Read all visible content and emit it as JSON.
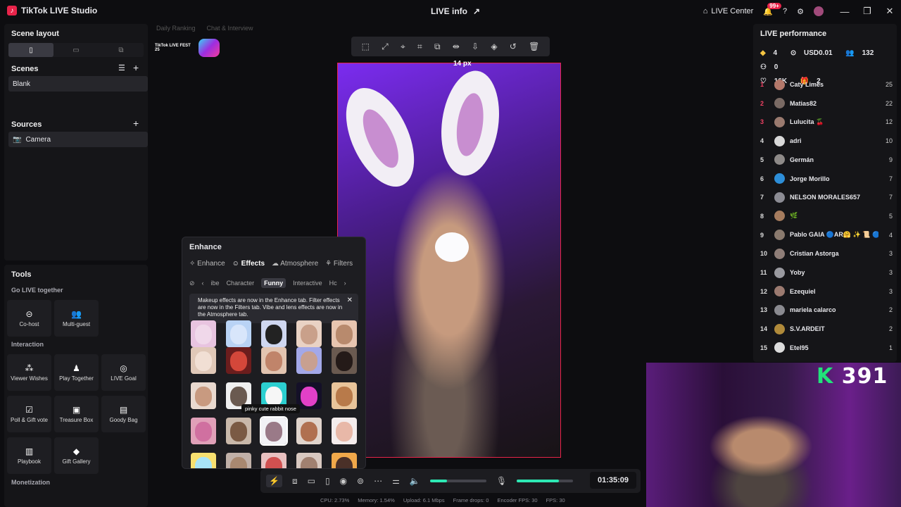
{
  "app": {
    "title": "TikTok LIVE Studio",
    "logo": "tiktok-icon"
  },
  "titlebar": {
    "center_title": "LIVE info",
    "live_center": "LIVE Center",
    "notif_badge": "99+"
  },
  "left": {
    "scene_layout": "Scene layout",
    "scenes_title": "Scenes",
    "scene_items": [
      "Blank"
    ],
    "sources_title": "Sources",
    "source_items": [
      "Camera"
    ],
    "tools_title": "Tools",
    "go_live_together": "Go LIVE together",
    "tools_group1": [
      "Co-host",
      "Multi-guest"
    ],
    "interaction": "Interaction",
    "tools_group2": [
      "Viewer Wishes",
      "Play Together",
      "LIVE Goal",
      "Poll & Gift vote",
      "Treasure Box",
      "Goody Bag",
      "Playbook",
      "Gift Gallery"
    ],
    "monetization": "Monetization"
  },
  "canvas": {
    "ranking_tabs": [
      "Daily Ranking",
      "Chat & Interview"
    ],
    "fest_logo_text": "TikTok LIVE FEST 25",
    "distance_label": "14 px"
  },
  "enhance": {
    "title": "Enhance",
    "tabs": [
      "Enhance",
      "Effects",
      "Atmosphere",
      "Filters"
    ],
    "active_tab": "Effects",
    "subtabs": [
      "ibe",
      "Character",
      "Funny",
      "Interactive",
      "Hc"
    ],
    "active_subtab": "Funny",
    "notice": "Makeup effects are now in the Enhance tab. Filter effects are now in the Filters tab. Vibe and lens effects are now in the Atmosphere tab.",
    "tooltip": "pinky cute rabbit nose"
  },
  "controls": {
    "timer": "01:35:09",
    "volume_level": 0.3,
    "mic_level": 0.75
  },
  "stats": [
    "CPU: 2.73%",
    "Memory: 1.54%",
    "Upload: 6.1 Mbps",
    "Frame drops: 0",
    "Encoder FPS: 30",
    "FPS: 30"
  ],
  "performance": {
    "title": "LIVE performance",
    "diamonds": "4",
    "usd": "USD0.01",
    "viewers": "132",
    "new_followers": "0",
    "likes": "16K",
    "gifts": "2"
  },
  "leaderboard": [
    {
      "rank": "1",
      "name": "Caty Limes",
      "score": "25",
      "color": "#b4786a"
    },
    {
      "rank": "2",
      "name": "Matias82",
      "score": "22",
      "color": "#7a6a64"
    },
    {
      "rank": "3",
      "name": "Lulucita 🍒",
      "score": "12",
      "color": "#9a7a6f"
    },
    {
      "rank": "4",
      "name": "adri",
      "score": "10",
      "color": "#d9d9d9"
    },
    {
      "rank": "5",
      "name": "Germán",
      "score": "9",
      "color": "#8e8a88"
    },
    {
      "rank": "6",
      "name": "Jorge Morillo",
      "score": "7",
      "color": "#2d8ed8"
    },
    {
      "rank": "7",
      "name": "NELSON MORALES657",
      "score": "7",
      "color": "#8c8c94"
    },
    {
      "rank": "8",
      "name": "🌿",
      "score": "5",
      "color": "#a67c5e"
    },
    {
      "rank": "9",
      "name": "Pablo GAIA 🔵AR🤗 ✨ 📜 🔵",
      "score": "4",
      "color": "#8a7a6e"
    },
    {
      "rank": "10",
      "name": "Cristian Astorga",
      "score": "3",
      "color": "#8f7e78"
    },
    {
      "rank": "11",
      "name": "Yoby",
      "score": "3",
      "color": "#9a9aa0"
    },
    {
      "rank": "12",
      "name": "Ezequiel",
      "score": "3",
      "color": "#9b7a70"
    },
    {
      "rank": "13",
      "name": "mariela calarco",
      "score": "2",
      "color": "#8a8a90"
    },
    {
      "rank": "14",
      "name": "S.V.ARDEIT",
      "score": "2",
      "color": "#b08a3a"
    },
    {
      "rank": "15",
      "name": "Etel95",
      "score": "1",
      "color": "#dcdcdc"
    }
  ],
  "overlay": {
    "k_letter": "K",
    "k_count": "391"
  }
}
